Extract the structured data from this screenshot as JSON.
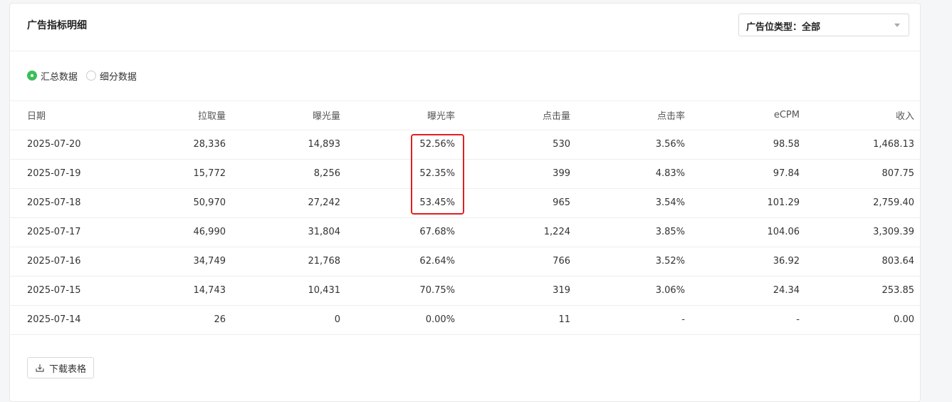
{
  "panel": {
    "title": "广告指标明细"
  },
  "filter": {
    "label": "广告位类型：全部"
  },
  "view_mode": {
    "options": [
      {
        "label": "汇总数据",
        "checked": true
      },
      {
        "label": "细分数据",
        "checked": false
      }
    ]
  },
  "table": {
    "columns": [
      "日期",
      "拉取量",
      "曝光量",
      "曝光率",
      "点击量",
      "点击率",
      "eCPM",
      "收入"
    ],
    "rows": [
      [
        "2025-07-20",
        "28,336",
        "14,893",
        "52.56%",
        "530",
        "3.56%",
        "98.58",
        "1,468.13"
      ],
      [
        "2025-07-19",
        "15,772",
        "8,256",
        "52.35%",
        "399",
        "4.83%",
        "97.84",
        "807.75"
      ],
      [
        "2025-07-18",
        "50,970",
        "27,242",
        "53.45%",
        "965",
        "3.54%",
        "101.29",
        "2,759.40"
      ],
      [
        "2025-07-17",
        "46,990",
        "31,804",
        "67.68%",
        "1,224",
        "3.85%",
        "104.06",
        "3,309.39"
      ],
      [
        "2025-07-16",
        "34,749",
        "21,768",
        "62.64%",
        "766",
        "3.52%",
        "36.92",
        "803.64"
      ],
      [
        "2025-07-15",
        "14,743",
        "10,431",
        "70.75%",
        "319",
        "3.06%",
        "24.34",
        "253.85"
      ],
      [
        "2025-07-14",
        "26",
        "0",
        "0.00%",
        "11",
        "-",
        "-",
        "0.00"
      ]
    ]
  },
  "actions": {
    "download_label": "下载表格"
  },
  "colors": {
    "accent_green": "#3cbe5a",
    "highlight_red": "#e02020"
  }
}
